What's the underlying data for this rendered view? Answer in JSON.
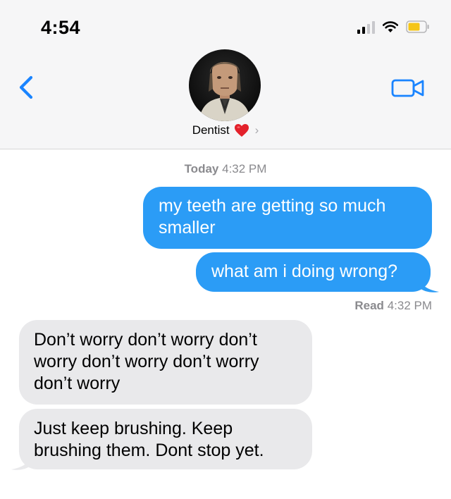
{
  "status_bar": {
    "time": "4:54",
    "icons": [
      "cellular-signal-icon",
      "wifi-icon",
      "battery-icon"
    ],
    "battery_color": "#f5c518"
  },
  "header": {
    "back_icon": "chevron-left-icon",
    "video_icon": "video-camera-icon",
    "contact_name": "Dentist",
    "name_emoji": "❤️",
    "chevron": "›"
  },
  "conversation": {
    "timestamp_day": "Today",
    "timestamp_time": "4:32 PM",
    "messages": [
      {
        "from": "me",
        "text": "my teeth are getting so much smaller"
      },
      {
        "from": "me",
        "text": "what am i doing wrong?"
      },
      {
        "from": "contact",
        "text": "Don’t worry don’t worry don’t worry don’t worry don’t worry don’t worry"
      },
      {
        "from": "contact",
        "text": "Just keep brushing. Keep brushing them. Dont stop yet."
      }
    ],
    "read_label": "Read",
    "read_time": "4:32 PM"
  },
  "colors": {
    "sent_bubble": "#2b9cf6",
    "received_bubble": "#e9e9eb",
    "accent": "#1a84ff"
  }
}
